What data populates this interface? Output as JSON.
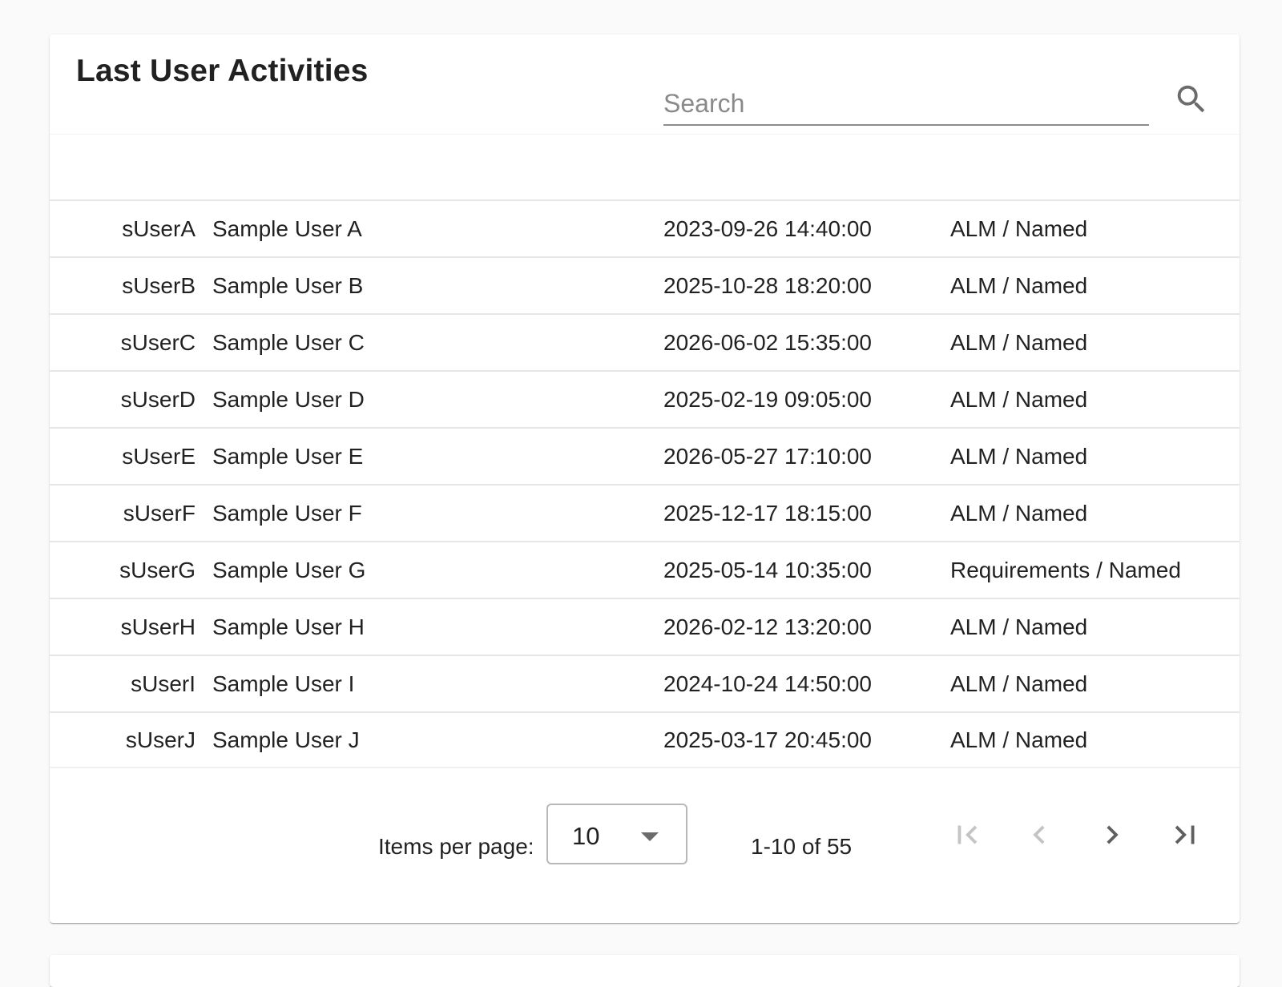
{
  "card": {
    "title": "Last User Activities",
    "search": {
      "placeholder": "Search",
      "value": ""
    }
  },
  "table": {
    "rows": [
      {
        "id": "sUserA",
        "name": "Sample User A",
        "date": "2023-09-26 14:40:00",
        "license": "ALM / Named"
      },
      {
        "id": "sUserB",
        "name": "Sample User B",
        "date": "2025-10-28 18:20:00",
        "license": "ALM / Named"
      },
      {
        "id": "sUserC",
        "name": "Sample User C",
        "date": "2026-06-02 15:35:00",
        "license": "ALM / Named"
      },
      {
        "id": "sUserD",
        "name": "Sample User D",
        "date": "2025-02-19 09:05:00",
        "license": "ALM / Named"
      },
      {
        "id": "sUserE",
        "name": "Sample User E",
        "date": "2026-05-27 17:10:00",
        "license": "ALM / Named"
      },
      {
        "id": "sUserF",
        "name": "Sample User F",
        "date": "2025-12-17 18:15:00",
        "license": "ALM / Named"
      },
      {
        "id": "sUserG",
        "name": "Sample User G",
        "date": "2025-05-14 10:35:00",
        "license": "Requirements / Named"
      },
      {
        "id": "sUserH",
        "name": "Sample User H",
        "date": "2026-02-12 13:20:00",
        "license": "ALM / Named"
      },
      {
        "id": "sUserI",
        "name": "Sample User I",
        "date": "2024-10-24 14:50:00",
        "license": "ALM / Named"
      },
      {
        "id": "sUserJ",
        "name": "Sample User J",
        "date": "2025-03-17 20:45:00",
        "license": "ALM / Named"
      }
    ]
  },
  "paginator": {
    "items_per_page_label": "Items per page:",
    "items_per_page_value": "10",
    "range_label": "1-10 of 55",
    "first_enabled": false,
    "prev_enabled": false,
    "next_enabled": true,
    "last_enabled": true
  },
  "colors": {
    "text": "#212121",
    "disabled_icon": "#c4c4c4",
    "enabled_icon": "#5f5f5f",
    "divider": "#e6e6e6"
  }
}
